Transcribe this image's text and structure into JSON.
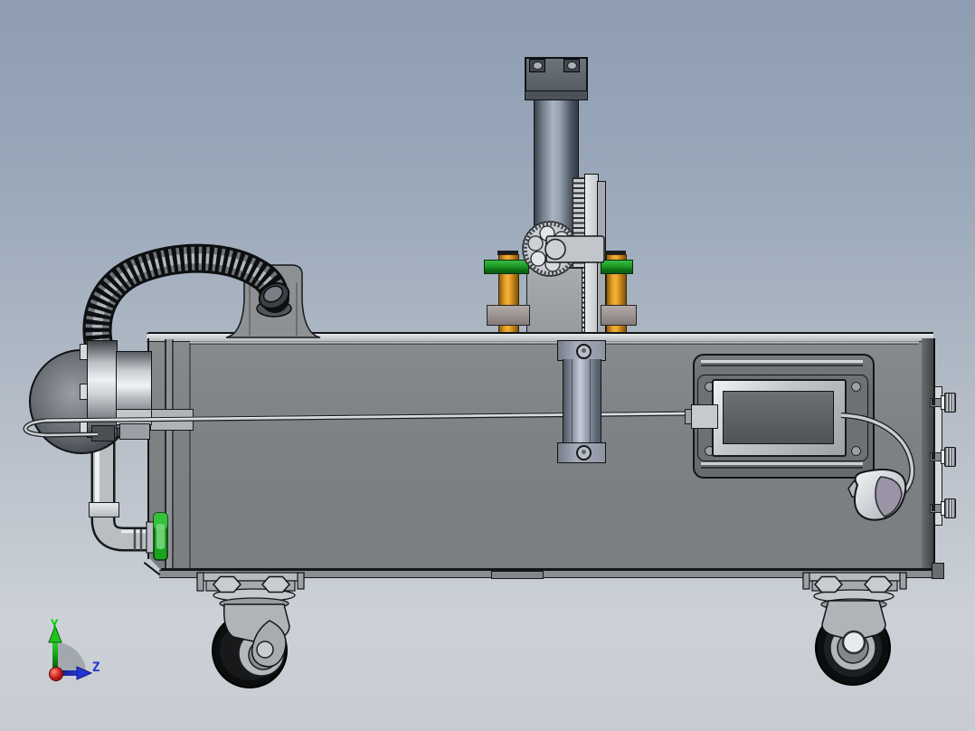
{
  "viewport": {
    "app": "cad-3d-viewport",
    "view_description": "Side view of a caster-mounted machine cart with vertical pneumatic cylinder, rack-and-pinion drive, gear motor with corrugated conduit, drain pipe with green fitting, recessed control panel with cable and nozzle knob",
    "projection": "orthographic side view"
  },
  "triad": {
    "y_label": "Y",
    "z_label": "Z",
    "y_color": "#00d000",
    "z_color": "#2232d4",
    "origin_color": "#c41414"
  },
  "colors": {
    "bg-top": "#8e9db1",
    "bg-bottom": "#ccd1d7",
    "box-face": "#7e8183",
    "box-top-strip": "#c9cdd0",
    "panel-plate": "#6b6e70",
    "recess-dark": "#595c5e",
    "metal-light": "#e8ebee",
    "metal-mid": "#b9bdc1",
    "green-plate": "#1f9a26",
    "green-fitting": "#18a91f",
    "orange-post": "#f3b13a",
    "taupe-block": "#9a918f",
    "hose-black": "#17181a",
    "tire-black": "#0c0d0e",
    "triad-y": "#00d000",
    "triad-z": "#2232d4",
    "triad-origin": "#c41414"
  },
  "components": [
    "machine-enclosure-box",
    "pneumatic-cylinder",
    "pinion-gear",
    "gear-rack",
    "guide-posts-orange",
    "mount-plates-green",
    "gear-motor",
    "corrugated-conduit",
    "drain-pipe-green-fitting",
    "wire-guide-wand",
    "control-panel-recess",
    "cable-and-knob",
    "thumb-screws",
    "swivel-caster-left",
    "swivel-caster-right",
    "origin-triad"
  ]
}
